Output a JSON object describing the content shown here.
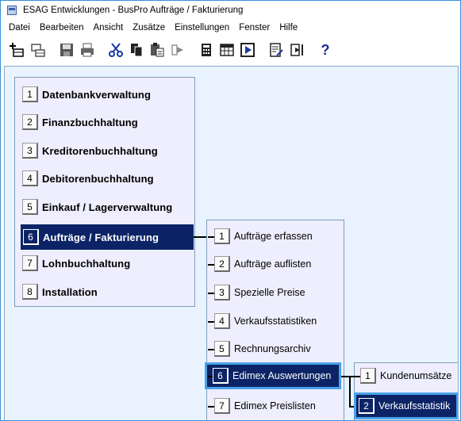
{
  "window": {
    "title": "ESAG Entwicklungen - BusPro Aufträge / Fakturierung"
  },
  "menubar": {
    "items": [
      "Datei",
      "Bearbeiten",
      "Ansicht",
      "Zusätze",
      "Einstellungen",
      "Fenster",
      "Hilfe"
    ]
  },
  "toolbar": {
    "icons": [
      "new-record-icon",
      "copy-record-icon",
      "save-icon",
      "print-icon",
      "cut-icon",
      "copy-icon",
      "paste-icon",
      "forward-icon",
      "calculator-icon",
      "calendar-icon",
      "play-icon",
      "edit-document-icon",
      "exit-icon",
      "help-icon"
    ],
    "help_label": "?"
  },
  "main_menu": {
    "items": [
      {
        "key": "1",
        "label": "Datenbankverwaltung"
      },
      {
        "key": "2",
        "label": "Finanzbuchhaltung"
      },
      {
        "key": "3",
        "label": "Kreditorenbuchhaltung"
      },
      {
        "key": "4",
        "label": "Debitorenbuchhaltung"
      },
      {
        "key": "5",
        "label": "Einkauf / Lagerverwaltung"
      },
      {
        "key": "6",
        "label": "Aufträge / Fakturierung",
        "selected": true
      },
      {
        "key": "7",
        "label": "Lohnbuchhaltung"
      },
      {
        "key": "8",
        "label": "Installation"
      }
    ]
  },
  "sub_menu": {
    "items": [
      {
        "key": "1",
        "label": "Aufträge erfassen"
      },
      {
        "key": "2",
        "label": "Aufträge auflisten"
      },
      {
        "key": "3",
        "label": "Spezielle Preise"
      },
      {
        "key": "4",
        "label": "Verkaufsstatistiken"
      },
      {
        "key": "5",
        "label": "Rechnungsarchiv"
      },
      {
        "key": "6",
        "label": "Edimex Auswertungen",
        "selected": true
      },
      {
        "key": "7",
        "label": "Edimex Preislisten"
      }
    ]
  },
  "sub_sub_menu": {
    "items": [
      {
        "key": "1",
        "label": "Kundenumsätze"
      },
      {
        "key": "2",
        "label": "Verkaufsstatistik",
        "selected": true
      }
    ]
  },
  "colors": {
    "selection": "#0c2466",
    "accent": "#4aa3e8",
    "panel": "#eeeefe",
    "workspace": "#e8f3ff"
  }
}
